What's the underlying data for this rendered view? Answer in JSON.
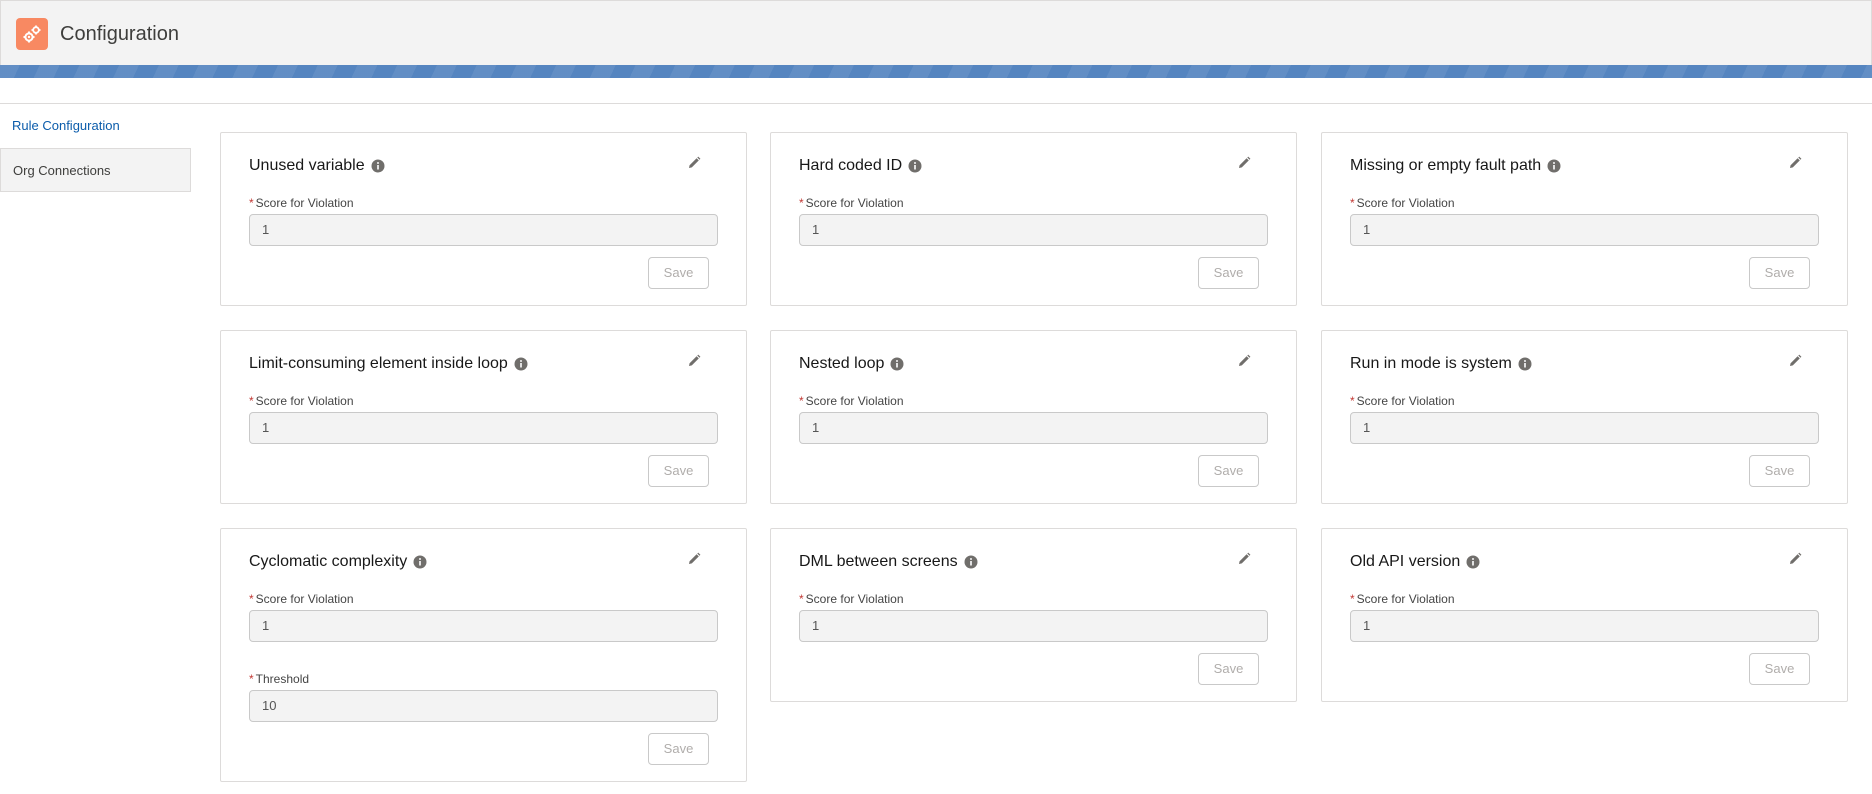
{
  "header": {
    "title": "Configuration",
    "icon": "gears-icon",
    "icon_color": "#f88962"
  },
  "nav": {
    "items": [
      {
        "label": "Rule Configuration",
        "active": true
      },
      {
        "label": "Org Connections",
        "active": false
      }
    ]
  },
  "common": {
    "score_label": "Score for Violation",
    "threshold_label": "Threshold",
    "save_label": "Save",
    "required_mark": "*"
  },
  "rules": [
    {
      "title": "Unused variable",
      "score": "1"
    },
    {
      "title": "Hard coded ID",
      "score": "1"
    },
    {
      "title": "Missing or empty fault path",
      "score": "1"
    },
    {
      "title": "Limit-consuming element inside loop",
      "score": "1"
    },
    {
      "title": "Nested loop",
      "score": "1"
    },
    {
      "title": "Run in mode is system",
      "score": "1"
    },
    {
      "title": "Cyclomatic complexity",
      "score": "1",
      "threshold": "10"
    },
    {
      "title": "DML between screens",
      "score": "1"
    },
    {
      "title": "Old API version",
      "score": "1"
    }
  ],
  "colors": {
    "accent_blue": "#5585c0",
    "link_blue": "#0b5cab",
    "required_red": "#c23934"
  }
}
